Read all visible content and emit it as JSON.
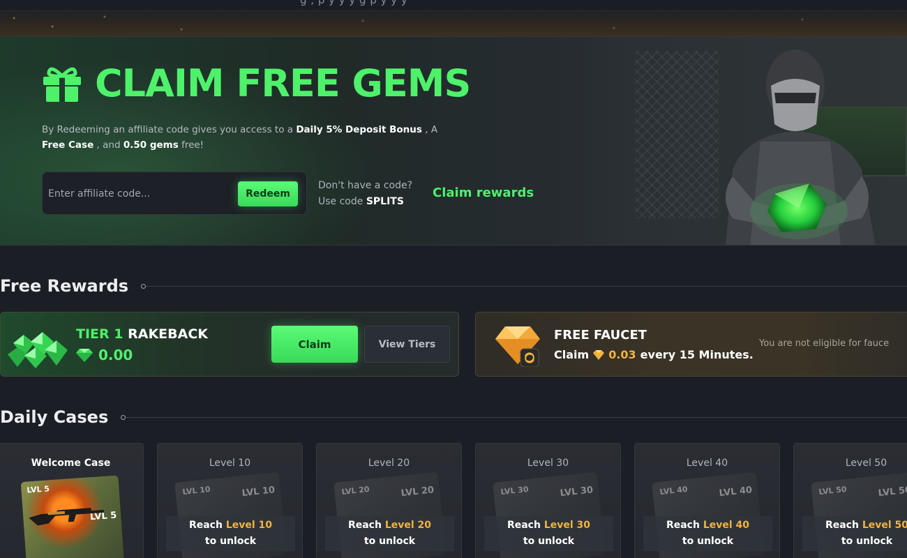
{
  "top_bar": {
    "ticker_text": "g                   ,         p  y  y  y  g             p  y  y  y"
  },
  "hero": {
    "title": "CLAIM FREE GEMS",
    "description_prefix": "By Redeeming an affiliate code gives you access to a",
    "bonus_highlight": "Daily 5% Deposit Bonus",
    "description_mid": ", A",
    "case_highlight": "Free Case",
    "description_and": ", and",
    "gems_highlight": "0.50 gems",
    "description_suffix": "free!",
    "code_input_placeholder": "Enter affiliate code...",
    "redeem_label": "Redeem",
    "hint_line1": "Don't have a code?",
    "hint_line2_prefix": "Use code",
    "hint_code": "SPLITS",
    "claim_rewards_label": "Claim rewards"
  },
  "free_rewards": {
    "section_title": "Free Rewards",
    "rakeback": {
      "tier_prefix": "TIER 1",
      "tier_suffix": "RAKEBACK",
      "amount": "0.00",
      "claim_label": "Claim",
      "view_tiers_label": "View Tiers"
    },
    "faucet": {
      "title": "FREE FAUCET",
      "sub_prefix": "Claim",
      "sub_amount": "0.03",
      "sub_suffix": "every 15 Minutes.",
      "ineligible_text": "You are not eligible for fauce"
    }
  },
  "daily_cases": {
    "section_title": "Daily Cases",
    "welcome": {
      "label": "Welcome Case",
      "art_lvl": "LVL 5",
      "art_lvl2": "LVL 5"
    },
    "locked": [
      {
        "label": "Level 10",
        "art": "LVL 10",
        "reach": "Reach",
        "level_text": "Level 10",
        "unlock": "to unlock"
      },
      {
        "label": "Level 20",
        "art": "LVL 20",
        "reach": "Reach",
        "level_text": "Level 20",
        "unlock": "to unlock"
      },
      {
        "label": "Level 30",
        "art": "LVL 30",
        "reach": "Reach",
        "level_text": "Level 30",
        "unlock": "to unlock"
      },
      {
        "label": "Level 40",
        "art": "LVL 40",
        "reach": "Reach",
        "level_text": "Level 40",
        "unlock": "to unlock"
      },
      {
        "label": "Level 50",
        "art": "LVL 50",
        "reach": "Reach",
        "level_text": "Level 50",
        "unlock": "to unlock"
      }
    ]
  },
  "colors": {
    "accent_green": "#4ef26a",
    "gold": "#f2b33d",
    "background": "#1b1e25"
  },
  "icons": [
    "gift-icon",
    "green-gem-icon",
    "gold-gem-icon",
    "refresh-badge-icon"
  ]
}
